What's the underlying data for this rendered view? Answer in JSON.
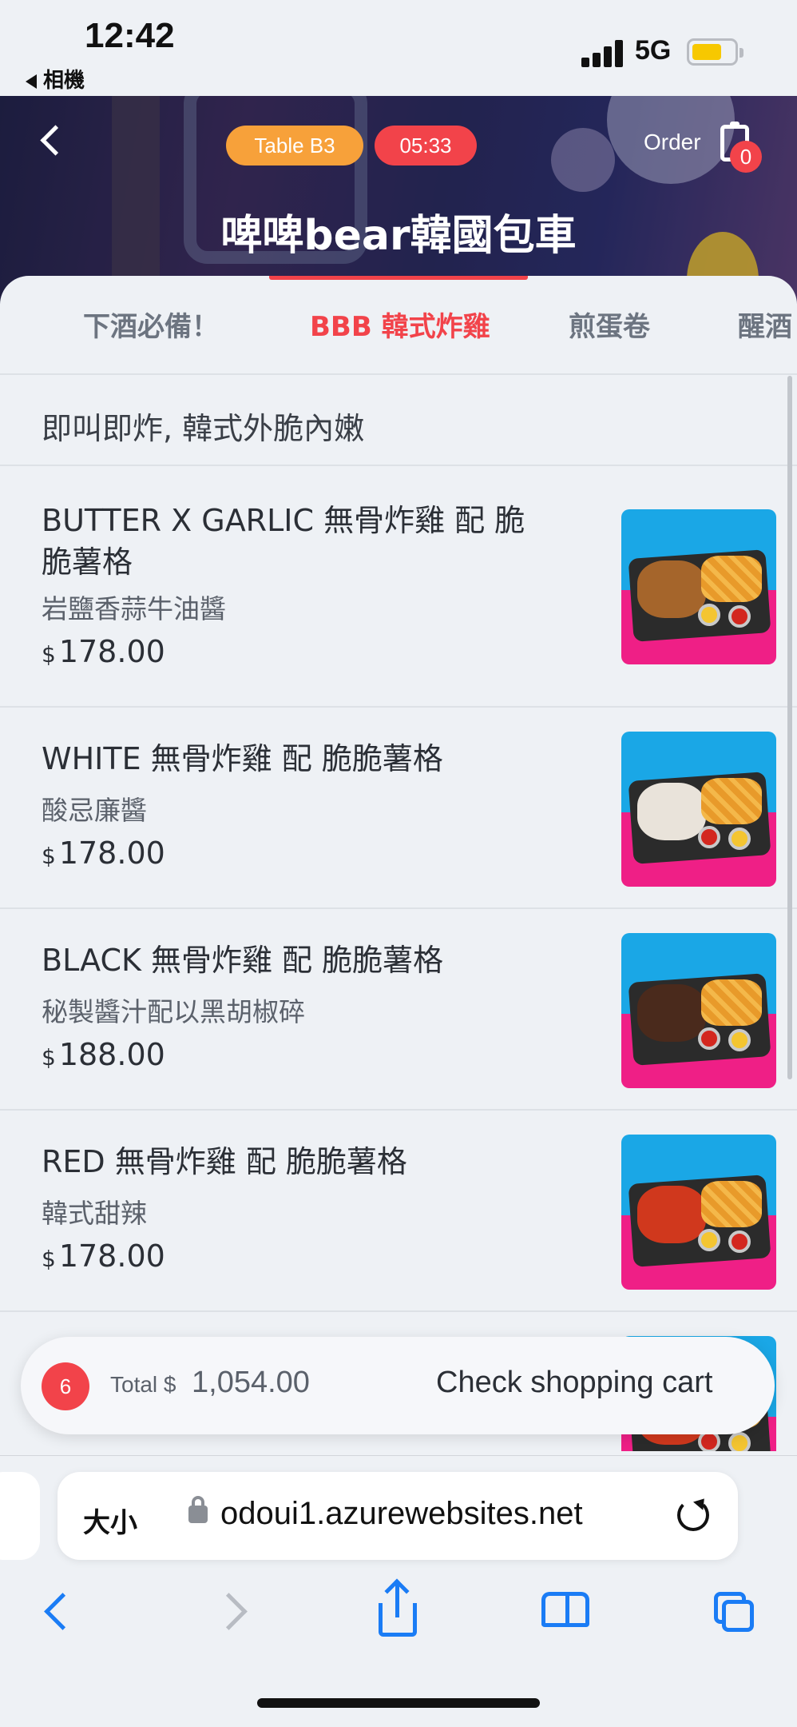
{
  "status_bar": {
    "time": "12:42",
    "back_app": "相機",
    "network": "5G"
  },
  "header": {
    "table_label": "Table  B3",
    "timer": "05:33",
    "order_label": "Order",
    "order_count": "0",
    "store_name": "啤啤bear韓國包車"
  },
  "category_tabs": [
    {
      "label": "下酒必備！",
      "active": false
    },
    {
      "label": "BBB 韓式炸雞",
      "active": true
    },
    {
      "label": "煎蛋卷",
      "active": false
    },
    {
      "label": "醒酒",
      "active": false
    }
  ],
  "category_description": "即叫即炸, 韓式外脆內嫩",
  "menu_items": [
    {
      "name": "BUTTER X GARLIC 無骨炸雞 配 脆脆薯格",
      "sub": "岩鹽香蒜牛油醬",
      "currency": "$",
      "price": "178.00",
      "food_color": "#a5652b"
    },
    {
      "name": "WHITE 無骨炸雞 配 脆脆薯格",
      "sub": "酸忌廉醬",
      "currency": "$",
      "price": "178.00",
      "food_color": "#e9e3da"
    },
    {
      "name": "BLACK 無骨炸雞 配 脆脆薯格",
      "sub": "秘製醬汁配以黑胡椒碎",
      "currency": "$",
      "price": "188.00",
      "food_color": "#4a2a1c"
    },
    {
      "name": "RED 無骨炸雞 配 脆脆薯格",
      "sub": "韓式甜辣",
      "currency": "$",
      "price": "178.00",
      "food_color": "#d0381d"
    }
  ],
  "cart": {
    "count": "6",
    "total_label": "Total $",
    "total_value": "1,054.00",
    "check_label": "Check shopping cart"
  },
  "browser": {
    "text_size": "大小",
    "url": "odoui1.azurewebsites.net"
  },
  "colors": {
    "accent_red": "#f2434a",
    "table_orange": "#f7a13a",
    "safari_blue": "#1a7cf5"
  }
}
